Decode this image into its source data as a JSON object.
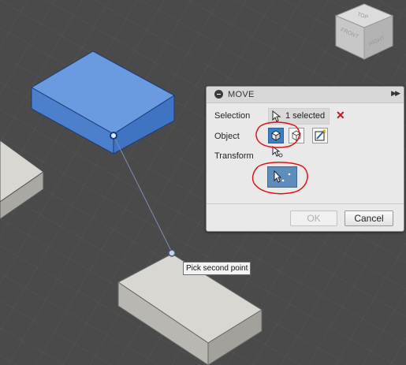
{
  "panel": {
    "title": "MOVE",
    "selection_label": "Selection",
    "selection_value": "1 selected",
    "object_label": "Object",
    "transform_label": "Transform",
    "ok_label": "OK",
    "cancel_label": "Cancel"
  },
  "viewcube": {
    "top_label": "TOP",
    "front_label": "FRONT",
    "right_label": "RIGHT"
  },
  "tooltip": {
    "text": "Pick second point"
  },
  "colors": {
    "canvas_bg": "#4a4a4a",
    "selected_body": "#5b8fd9",
    "body": "#d8d7d2",
    "accent": "#3d7fc5",
    "annotation": "#e0101a",
    "clear_icon": "#c0161a"
  },
  "icons": [
    "collapse-icon",
    "expand-icon",
    "cursor-arrow-icon",
    "clear-x-icon",
    "body-icon",
    "component-icon",
    "sketch-icon",
    "free-move-icon",
    "point-to-point-icon"
  ]
}
